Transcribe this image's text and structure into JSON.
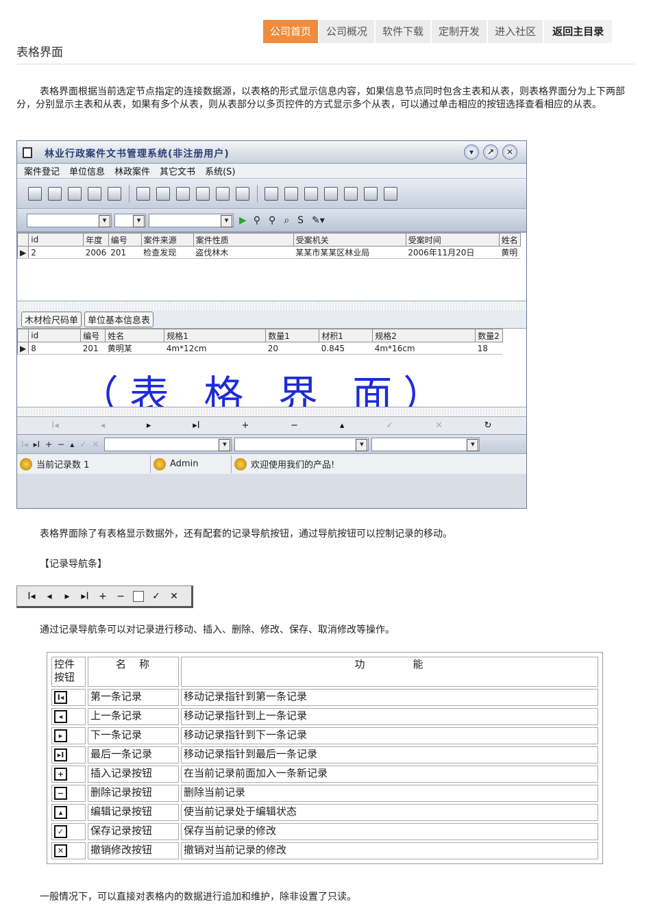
{
  "nav": {
    "items": [
      "公司首页",
      "公司概况",
      "软件下载",
      "定制开发",
      "进入社区",
      "返回主目录"
    ]
  },
  "page": {
    "title": "表格界面",
    "intro": "表格界面根据当前选定节点指定的连接数据源，以表格的形式显示信息内容，如果信息节点同时包含主表和从表，则表格界面分为上下两部分，分别显示主表和从表，如果有多个从表，则从表部分以多页控件的方式显示多个从表，可以通过单击相应的按钮选择查看相应的从表。",
    "para2": "表格界面除了有表格显示数据外，还有配套的记录导航按钮，通过导航按钮可以控制记录的移动。",
    "section": "【记录导航条】",
    "para3": "通过记录导航条可以对记录进行移动、插入、删除、修改、保存、取消修改等操作。",
    "para4": "一般情况下，可以直接对表格内的数据进行追加和维护，除非设置了只读。"
  },
  "app": {
    "title": "林业行政案件文书管理系统(非注册用户)",
    "menu": [
      "案件登记",
      "单位信息",
      "林政案件",
      "其它文书",
      "系统(S)"
    ],
    "master": {
      "headers": [
        "id",
        "年度",
        "编号",
        "案件来源",
        "案件性质",
        "受案机关",
        "受案时间",
        "姓名"
      ],
      "row": [
        "2",
        "2006",
        "201",
        "检查发现",
        "盗伐林木",
        "某某市某某区林业局",
        "2006年11月20日",
        "黄明"
      ]
    },
    "detail_tabs": [
      "木材检尺码单",
      "单位基本信息表"
    ],
    "detail": {
      "headers": [
        "id",
        "编号",
        "姓名",
        "规格1",
        "数量1",
        "材积1",
        "规格2",
        "数量2"
      ],
      "row": [
        "8",
        "201",
        "黄明某",
        "4m*12cm",
        "20",
        "0.845",
        "4m*16cm",
        "18"
      ]
    },
    "watermark": "（表 格 界 面）",
    "status": {
      "records": "当前记录数 1",
      "user": "Admin",
      "welcome": "欢迎使用我们的产品!"
    }
  },
  "recnav_symbols": [
    "I◂",
    "◂",
    "▸",
    "▸I",
    "+",
    "−",
    "",
    "✓",
    "✕"
  ],
  "table": {
    "headers": [
      "控件按钮",
      "名　称",
      "功　　　　能"
    ],
    "rows": [
      {
        "icon": "I◂",
        "name": "第一条记录",
        "func": "移动记录指针到第一条记录"
      },
      {
        "icon": "◂",
        "name": "上一条记录",
        "func": "移动记录指针到上一条记录"
      },
      {
        "icon": "▸",
        "name": "下一条记录",
        "func": "移动记录指针到下一条记录"
      },
      {
        "icon": "▸I",
        "name": "最后一条记录",
        "func": "移动记录指针到最后一条记录"
      },
      {
        "icon": "+",
        "name": "插入记录按钮",
        "func": "在当前记录前面加入一条新记录"
      },
      {
        "icon": "−",
        "name": "删除记录按钮",
        "func": "删除当前记录"
      },
      {
        "icon": "▴",
        "name": "编辑记录按钮",
        "func": "使当前记录处于编辑状态"
      },
      {
        "icon": "✓",
        "name": "保存记录按钮",
        "func": "保存当前记录的修改"
      },
      {
        "icon": "✕",
        "name": "撤销修改按钮",
        "func": "撤销对当前记录的修改"
      }
    ]
  }
}
